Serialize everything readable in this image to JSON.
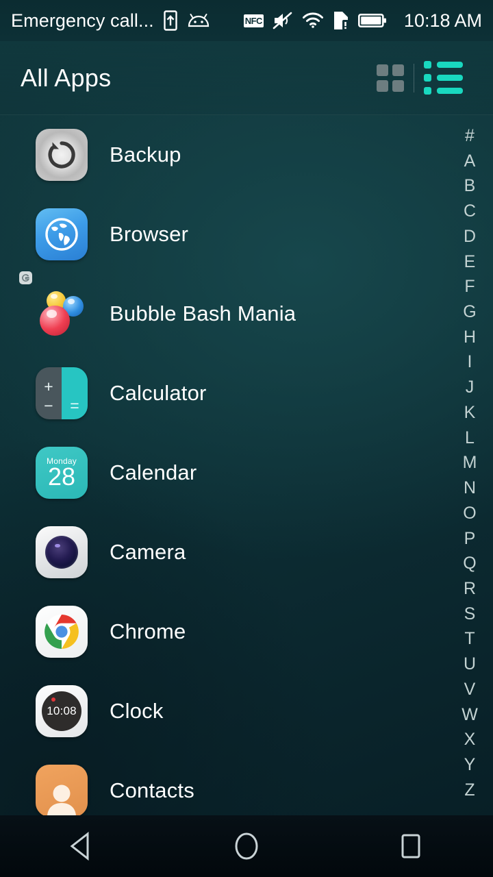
{
  "status_bar": {
    "carrier": "Emergency call...",
    "left_icons": [
      {
        "name": "sim-card-upload-icon",
        "label": "sim-upload"
      },
      {
        "name": "android-robot-icon",
        "label": "android"
      }
    ],
    "right_icons": [
      {
        "name": "nfc-icon",
        "label": "NFC"
      },
      {
        "name": "volume-mute-icon",
        "label": "muted"
      },
      {
        "name": "wifi-icon",
        "label": "wifi"
      },
      {
        "name": "sd-card-alert-icon",
        "label": "sd-alert"
      },
      {
        "name": "battery-full-icon",
        "label": "battery"
      }
    ],
    "time": "10:18 AM"
  },
  "header": {
    "title": "All Apps",
    "grid_view": {
      "name": "grid-view-icon",
      "active": false,
      "color": "#6d7d80"
    },
    "list_view": {
      "name": "list-view-icon",
      "active": true,
      "color": "#19d8bf"
    }
  },
  "apps": [
    {
      "label": "Backup",
      "icon": "backup-icon"
    },
    {
      "label": "Browser",
      "icon": "browser-icon"
    },
    {
      "label": "Bubble Bash Mania",
      "icon": "bubble-bash-mania-icon"
    },
    {
      "label": "Calculator",
      "icon": "calculator-icon"
    },
    {
      "label": "Calendar",
      "icon": "calendar-icon"
    },
    {
      "label": "Camera",
      "icon": "camera-icon"
    },
    {
      "label": "Chrome",
      "icon": "chrome-icon"
    },
    {
      "label": "Clock",
      "icon": "clock-icon"
    },
    {
      "label": "Contacts",
      "icon": "contacts-icon"
    }
  ],
  "icon_details": {
    "calculator": {
      "plus": "+",
      "minus": "−",
      "equals": "="
    },
    "calendar": {
      "day_of_week": "Monday",
      "day_number": "28"
    },
    "clock": {
      "time": "10:08"
    }
  },
  "alphabet_index": [
    "#",
    "A",
    "B",
    "C",
    "D",
    "E",
    "F",
    "G",
    "H",
    "I",
    "J",
    "K",
    "L",
    "M",
    "N",
    "O",
    "P",
    "Q",
    "R",
    "S",
    "T",
    "U",
    "V",
    "W",
    "X",
    "Y",
    "Z"
  ],
  "nav_bar": [
    {
      "name": "back-button",
      "label": "Back"
    },
    {
      "name": "home-button",
      "label": "Home"
    },
    {
      "name": "recents-button",
      "label": "Recent apps"
    }
  ],
  "colors": {
    "accent_teal": "#19d8bf",
    "inactive_gray": "#6d7d80",
    "background_top": "#11383d",
    "background_bottom": "#071d24",
    "text_primary": "#ffffff",
    "index_text": "#c3d2d2"
  }
}
